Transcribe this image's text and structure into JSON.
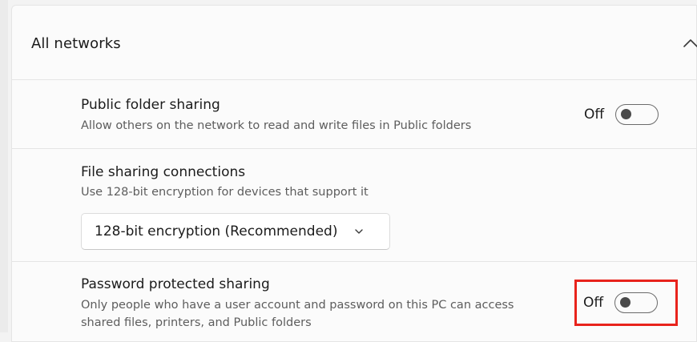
{
  "section": {
    "title": "All networks",
    "chevron_icon": "chevron-up-icon"
  },
  "public_folder": {
    "title": "Public folder sharing",
    "description": "Allow others on the network to read and write files in Public folders",
    "toggle_label": "Off"
  },
  "file_sharing": {
    "title": "File sharing connections",
    "description": "Use 128-bit encryption for devices that support it",
    "dropdown_value": "128-bit encryption (Recommended)",
    "dropdown_icon": "chevron-down-icon"
  },
  "password_sharing": {
    "title": "Password protected sharing",
    "description_line1": "Only people who have a user account and password on this PC can access",
    "description_line2": "shared files, printers, and Public folders",
    "toggle_label": "Off"
  },
  "colors": {
    "highlight": "#e8231c",
    "background": "#f3f3f3",
    "card": "#fbfbfb"
  }
}
